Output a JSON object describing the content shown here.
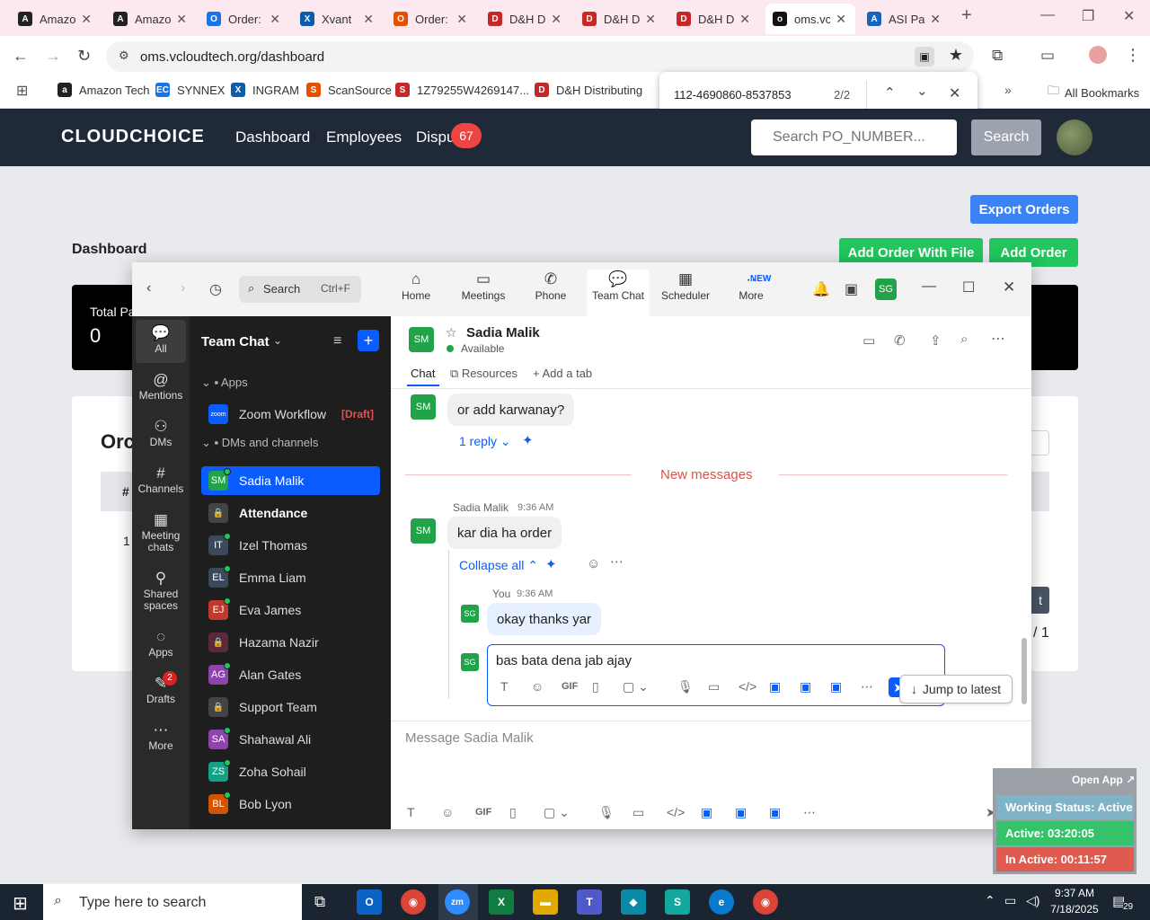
{
  "browser": {
    "tabs": [
      {
        "title": "Amazo",
        "icon": "amazon-icon",
        "color": "#222"
      },
      {
        "title": "Amazo",
        "icon": "amazon-icon",
        "color": "#222"
      },
      {
        "title": "Order:",
        "icon": "ec-icon",
        "color": "#1a73e8"
      },
      {
        "title": "Xvant",
        "icon": "xvant-icon",
        "color": "#0b5cad"
      },
      {
        "title": "Order:",
        "icon": "s-icon",
        "color": "#e65100"
      },
      {
        "title": "D&H D",
        "icon": "dh-icon",
        "color": "#c62828"
      },
      {
        "title": "D&H D",
        "icon": "dh-icon",
        "color": "#c62828"
      },
      {
        "title": "D&H D",
        "icon": "dh-icon",
        "color": "#c62828"
      },
      {
        "title": "oms.vc",
        "icon": "vcloud-icon",
        "color": "#111"
      },
      {
        "title": "ASI Pa",
        "icon": "asi-icon",
        "color": "#1565c0"
      }
    ],
    "url": "oms.vcloudtech.org/dashboard",
    "bookmarks": [
      "Amazon Tech",
      "SYNNEX",
      "INGRAM",
      "ScanSource",
      "1Z79255W4269147...",
      "D&H Distributing"
    ],
    "all_bookmarks": "All Bookmarks",
    "find": {
      "query": "112-4690860-8537853",
      "count": "2/2"
    }
  },
  "site": {
    "logo": "CLOUDCHOICE",
    "nav": [
      "Dashboard",
      "Employees",
      "Dispu"
    ],
    "disputes_badge": "67",
    "search_placeholder": "Search PO_NUMBER...",
    "search_button": "Search",
    "export_button": "Export Orders",
    "page_title": "Dashboard",
    "add_file_button": "Add Order With File",
    "add_order_button": "Add Order",
    "total_label": "Total Pa",
    "total_value": "0",
    "orders_heading": "Orc",
    "table_hash": "#",
    "row_num": "1",
    "partial_btn": "t",
    "pagination": "/ 1"
  },
  "zoom": {
    "search_label": "Search",
    "search_shortcut": "Ctrl+F",
    "top_tabs": [
      "Home",
      "Meetings",
      "Phone",
      "Team Chat",
      "Scheduler",
      "More"
    ],
    "new_badge": "NEW",
    "profile": "SG",
    "rail": [
      {
        "label": "All",
        "icon": "chat-bubble-icon"
      },
      {
        "label": "Mentions",
        "icon": "at-icon"
      },
      {
        "label": "DMs",
        "icon": "people-icon"
      },
      {
        "label": "Channels",
        "icon": "hash-icon"
      },
      {
        "label": "Meeting chats",
        "icon": "calendar-icon"
      },
      {
        "label": "Shared spaces",
        "icon": "shared-icon"
      },
      {
        "label": "Apps",
        "icon": "apps-icon"
      },
      {
        "label": "Drafts",
        "icon": "drafts-icon"
      },
      {
        "label": "More",
        "icon": "more-icon"
      }
    ],
    "drafts_badge": "2",
    "team_chat_title": "Team Chat",
    "apps_section": "Apps",
    "workflow": "Zoom Workflow",
    "draft_tag": "[Draft]",
    "dms_section": "DMs and channels",
    "channels": [
      {
        "initials": "SM",
        "name": "Sadia Malik",
        "color": "#22a34a"
      },
      {
        "initials": "",
        "name": "Attendance",
        "color": "#444"
      },
      {
        "initials": "IT",
        "name": "Izel Thomas",
        "color": "#3a4a5a"
      },
      {
        "initials": "EL",
        "name": "Emma Liam",
        "color": "#3a4a5a"
      },
      {
        "initials": "EJ",
        "name": "Eva James",
        "color": "#c0392b"
      },
      {
        "initials": "",
        "name": "Hazama Nazir",
        "color": "#5a2a3a"
      },
      {
        "initials": "AG",
        "name": "Alan Gates",
        "color": "#8e44ad"
      },
      {
        "initials": "",
        "name": "Support Team",
        "color": "#444"
      },
      {
        "initials": "SA",
        "name": "Shahawal Ali",
        "color": "#8e44ad"
      },
      {
        "initials": "ZS",
        "name": "Zoha Sohail",
        "color": "#16a085"
      },
      {
        "initials": "BL",
        "name": "Bob Lyon",
        "color": "#d35400"
      }
    ],
    "contact": {
      "initials": "SM",
      "name": "Sadia Malik",
      "status": "Available"
    },
    "sub_tabs": [
      "Chat",
      "Resources",
      "Add a tab"
    ],
    "messages": {
      "m1": "or add karwanay?",
      "reply_link": "1 reply",
      "new_messages": "New messages",
      "m2_sender": "Sadia Malik",
      "m2_time": "9:36 AM",
      "m2": "kar dia ha order",
      "collapse": "Collapse all",
      "m3_sender": "You",
      "m3_time": "9:36 AM",
      "m3": "okay thanks yar",
      "draft": "bas bata dena jab ajay",
      "jump": "Jump to latest",
      "composer_placeholder": "Message Sadia Malik"
    },
    "gif": "GIF"
  },
  "work_status": {
    "open_app": "Open App",
    "status": "Working Status: Active",
    "active": "Active: 03:20:05",
    "inactive": "In Active: 00:11:57"
  },
  "taskbar": {
    "search": "Type here to search",
    "time": "9:37 AM",
    "date": "7/18/2025",
    "notif": "29"
  }
}
